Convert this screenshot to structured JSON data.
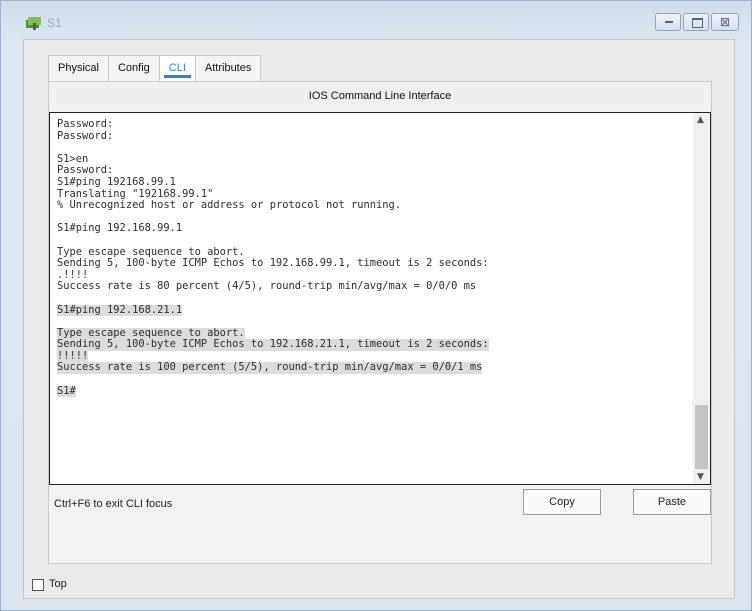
{
  "window": {
    "title": "S1",
    "controls": {
      "minimize_icon": "minimize-icon",
      "maximize_icon": "maximize-icon",
      "close_icon": "close-icon",
      "close_glyph": "⊠"
    }
  },
  "tabs": [
    {
      "label": "Physical",
      "active": false
    },
    {
      "label": "Config",
      "active": false
    },
    {
      "label": "CLI",
      "active": true
    },
    {
      "label": "Attributes",
      "active": false
    }
  ],
  "panel": {
    "title": "IOS Command Line Interface"
  },
  "terminal": {
    "lines": [
      "Password:",
      "Password:",
      "",
      "S1>en",
      "Password:",
      "S1#ping 192168.99.1",
      "Translating \"192168.99.1\"",
      "% Unrecognized host or address or protocol not running.",
      "",
      "S1#ping 192.168.99.1",
      "",
      "Type escape sequence to abort.",
      "Sending 5, 100-byte ICMP Echos to 192.168.99.1, timeout is 2 seconds:",
      ".!!!!",
      "Success rate is 80 percent (4/5), round-trip min/avg/max = 0/0/0 ms",
      "",
      "S1#ping 192.168.21.1",
      "",
      "Type escape sequence to abort.",
      "Sending 5, 100-byte ICMP Echos to 192.168.21.1, timeout is 2 seconds:",
      "!!!!!",
      "Success rate is 100 percent (5/5), round-trip min/avg/max = 0/0/1 ms",
      "",
      "S1#"
    ],
    "selected_lines": [
      16,
      18,
      19,
      20,
      21,
      23
    ]
  },
  "footer": {
    "hint": "Ctrl+F6 to exit CLI focus",
    "copy_label": "Copy",
    "paste_label": "Paste"
  },
  "bottom": {
    "top_label": "Top",
    "top_checked": false
  },
  "colors": {
    "accent": "#2f83d6",
    "window_bg": "#dbe5f1",
    "terminal_text": "#2e2e2e"
  }
}
